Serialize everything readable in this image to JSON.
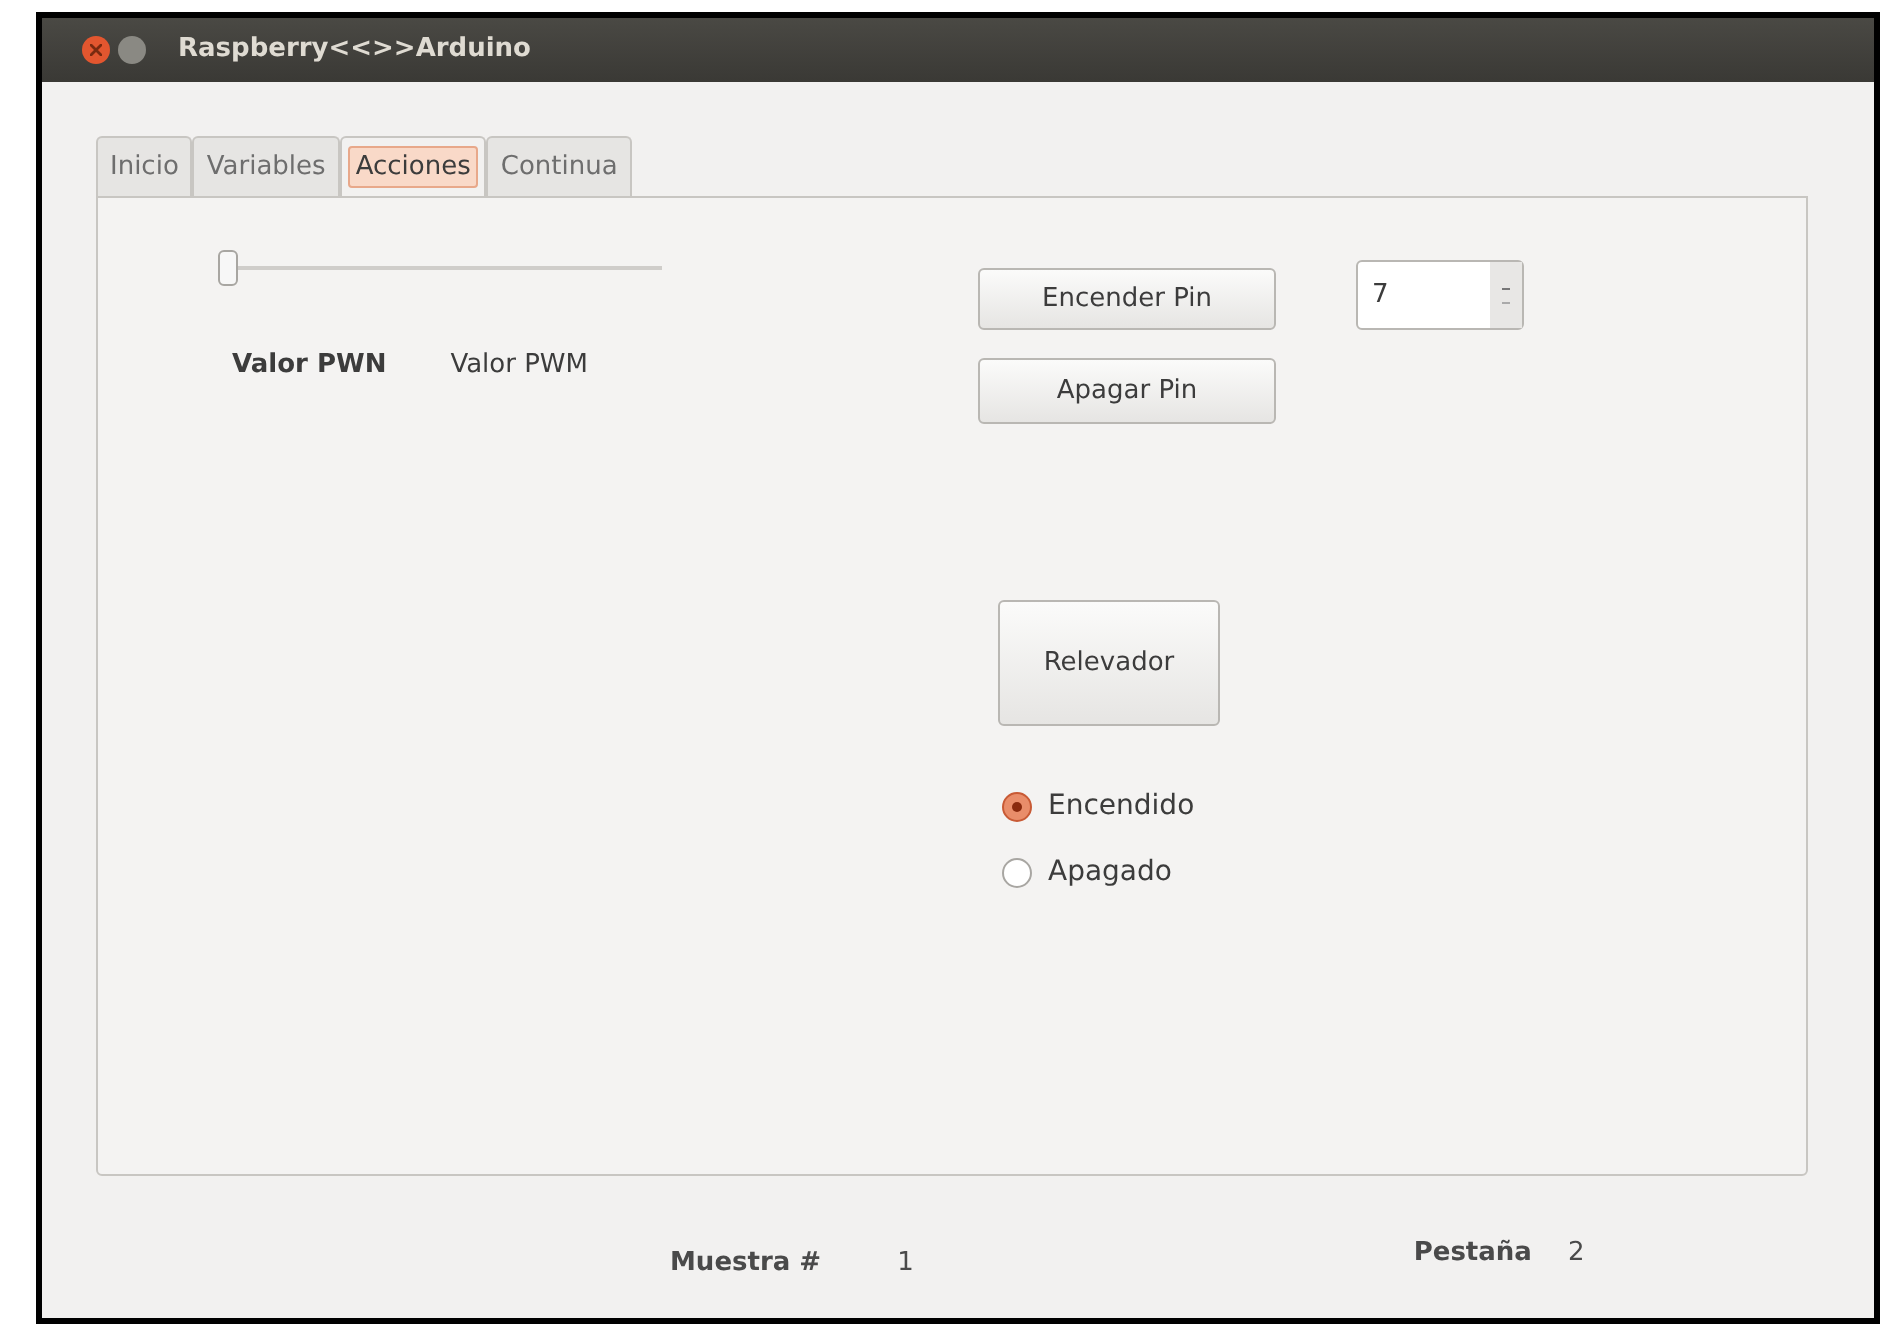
{
  "window": {
    "title": "Raspberry<<>>Arduino"
  },
  "tabs": [
    {
      "label": "Inicio",
      "selected": false
    },
    {
      "label": "Variables",
      "selected": false
    },
    {
      "label": "Acciones",
      "selected": true
    },
    {
      "label": "Continua",
      "selected": false
    }
  ],
  "pwm": {
    "level": 0.0,
    "label": "Valor PWN",
    "value": "Valor PWM"
  },
  "buttons": {
    "on": "Encender Pin",
    "off": "Apagar Pin",
    "relay": "Relevador"
  },
  "pin_spinner": {
    "value": "7"
  },
  "radios": [
    {
      "label": "Encendido",
      "selected": true
    },
    {
      "label": "Apagado",
      "selected": false
    }
  ],
  "status": {
    "sample_label": "Muestra #",
    "sample_value": "1",
    "tab_label": "Pestaña",
    "tab_value": "2"
  }
}
